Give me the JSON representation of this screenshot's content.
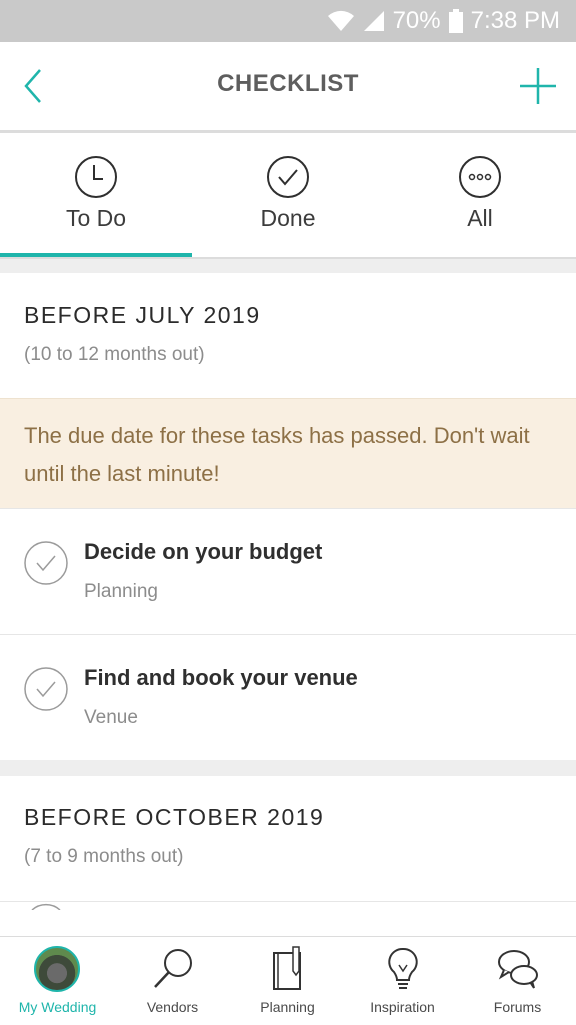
{
  "status_bar": {
    "battery": "70%",
    "time": "7:38 PM"
  },
  "header": {
    "title": "CHECKLIST"
  },
  "tabs": [
    {
      "label": "To Do",
      "icon": "clock-icon",
      "active": true
    },
    {
      "label": "Done",
      "icon": "checkmark-circle-icon",
      "active": false
    },
    {
      "label": "All",
      "icon": "more-circle-icon",
      "active": false
    }
  ],
  "sections": [
    {
      "title": "BEFORE JULY 2019",
      "subtitle": "(10 to 12 months out)",
      "warning": "The due date for these tasks has passed. Don't wait until the last minute!",
      "tasks": [
        {
          "name": "Decide on your budget",
          "category": "Planning"
        },
        {
          "name": "Find and book your venue",
          "category": "Venue"
        }
      ]
    },
    {
      "title": "BEFORE OCTOBER 2019",
      "subtitle": "(7 to 9 months out)"
    }
  ],
  "bottom_nav": [
    {
      "label": "My Wedding",
      "icon": "avatar",
      "active": true
    },
    {
      "label": "Vendors",
      "icon": "search-icon",
      "active": false
    },
    {
      "label": "Planning",
      "icon": "notebook-icon",
      "active": false
    },
    {
      "label": "Inspiration",
      "icon": "lightbulb-icon",
      "active": false
    },
    {
      "label": "Forums",
      "icon": "chat-bubbles-icon",
      "active": false
    }
  ],
  "colors": {
    "accent": "#1fb5ab",
    "warning_bg": "#f9efe1",
    "warning_text": "#8d7046"
  }
}
